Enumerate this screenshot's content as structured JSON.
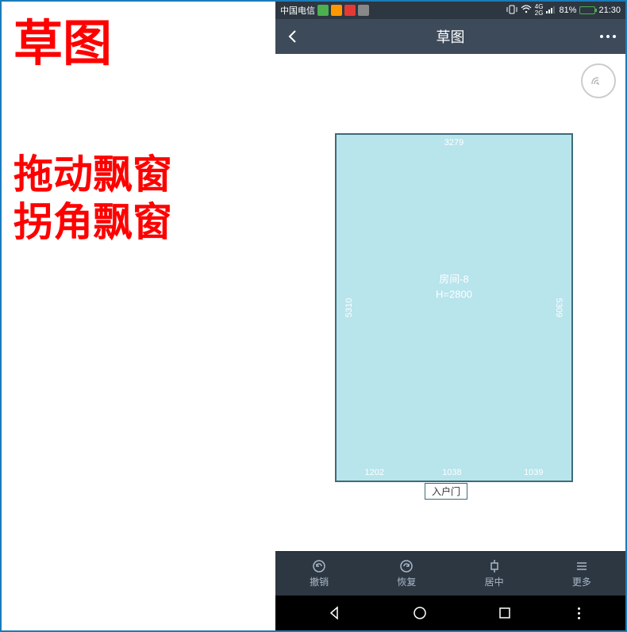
{
  "annotation": {
    "title": "草图",
    "line1": "拖动飘窗",
    "line2": "拐角飘窗"
  },
  "status_bar": {
    "carrier": "中国电信",
    "signal_type": "4G",
    "signal_sub": "2G",
    "battery_percent": "81%",
    "time": "21:30"
  },
  "header": {
    "title": "草图"
  },
  "room": {
    "dim_top": "3279",
    "dim_left": "5310",
    "dim_right": "5309",
    "dim_bottom_left": "1202",
    "dim_bottom_mid": "1038",
    "dim_bottom_right": "1039",
    "name": "房间-8",
    "height_label": "H=2800",
    "door_label": "入户门"
  },
  "toolbar": {
    "undo": "撤销",
    "redo": "恢复",
    "center": "居中",
    "more": "更多"
  }
}
